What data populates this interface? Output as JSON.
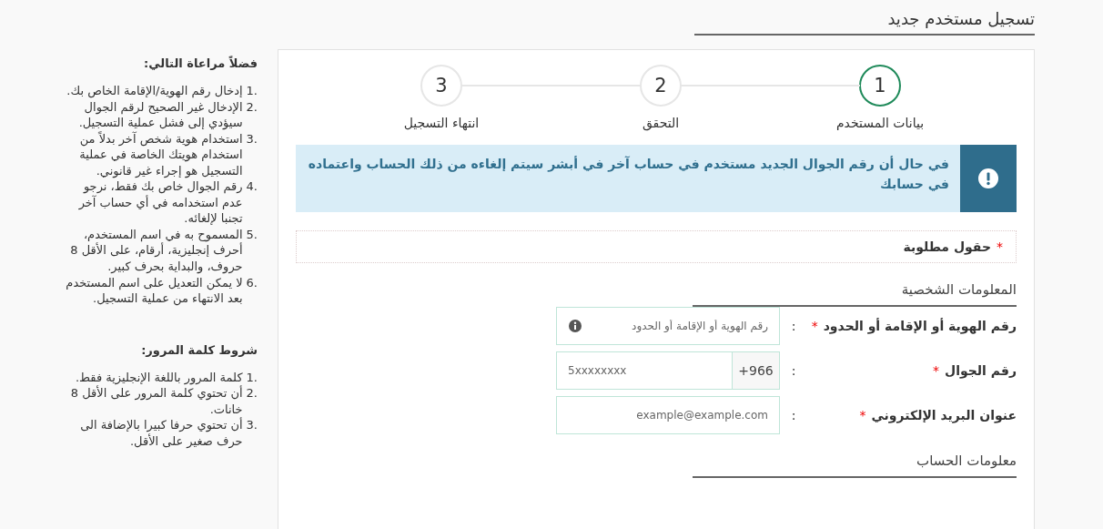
{
  "page_title": "تسجيل مستخدم جديد",
  "steps": [
    {
      "number": "1",
      "label": "بيانات المستخدم",
      "selected": true
    },
    {
      "number": "2",
      "label": "التحقق",
      "selected": false
    },
    {
      "number": "3",
      "label": "انتهاء التسجيل",
      "selected": false
    }
  ],
  "alert": {
    "text": "في حال أن رقم الجوال الجديد مستخدم في حساب آخر في أبشر سيتم إلغاءه من ذلك الحساب واعتماده في حسابك"
  },
  "required_note": {
    "star": "*",
    "text": "حقول مطلوبة"
  },
  "sections": [
    {
      "title": "المعلومات الشخصية",
      "fields": [
        {
          "kind": "info",
          "label": "رقم الهوية أو الإقامة أو الحدود",
          "star": "*",
          "colon": ":",
          "placeholder": "رقم الهوية أو الإقامة أو الحدود"
        },
        {
          "kind": "phone",
          "label": "رقم الجوال",
          "star": "*",
          "colon": ":",
          "prefix": "+966",
          "placeholder": "5xxxxxxxx"
        },
        {
          "kind": "text",
          "label": "عنوان البريد الإلكتروني",
          "star": "*",
          "colon": ":",
          "placeholder": "example@example.com"
        }
      ]
    },
    {
      "title": "معلومات الحساب"
    }
  ],
  "sidebar": [
    {
      "title": "فضلاً مراعاة التالي:",
      "items": [
        {
          "number": "1.",
          "text": "إدخال رقم الهوية/الإقامة الخاص بك."
        },
        {
          "number": "2.",
          "text": "الإدخال غير الصحيح لرقم الجوال سيؤدي إلى فشل عملية التسجيل."
        },
        {
          "number": "3.",
          "text": "استخدام هوية شخص آخر بدلاً من استخدام هويتك الخاصة في عملية التسجيل هو إجراء غير قانوني."
        },
        {
          "number": "4.",
          "text": "رقم الجوال خاص بك فقط، نرجو عدم استخدامه في أي حساب آخر تجنبا لإلغائه."
        },
        {
          "number": "5.",
          "text": "المسموح به في اسم المستخدم، أحرف إنجليزية، أرقام، على الأقل 8 حروف، والبداية بحرف كبير."
        },
        {
          "number": "6.",
          "text": "لا يمكن التعديل على اسم المستخدم بعد الانتهاء من عملية التسجيل."
        }
      ]
    },
    {
      "title": "شروط كلمة المرور:",
      "items": [
        {
          "number": "1.",
          "text": "كلمة المرور باللغة الإنجليزية فقط."
        },
        {
          "number": "2.",
          "text": "أن تحتوي كلمة المرور على الأقل 8 خانات."
        },
        {
          "number": "3.",
          "text": "أن تحتوي حرفا كبيرا بالإضافة الى حرف صغير على الأقل."
        }
      ]
    }
  ]
}
